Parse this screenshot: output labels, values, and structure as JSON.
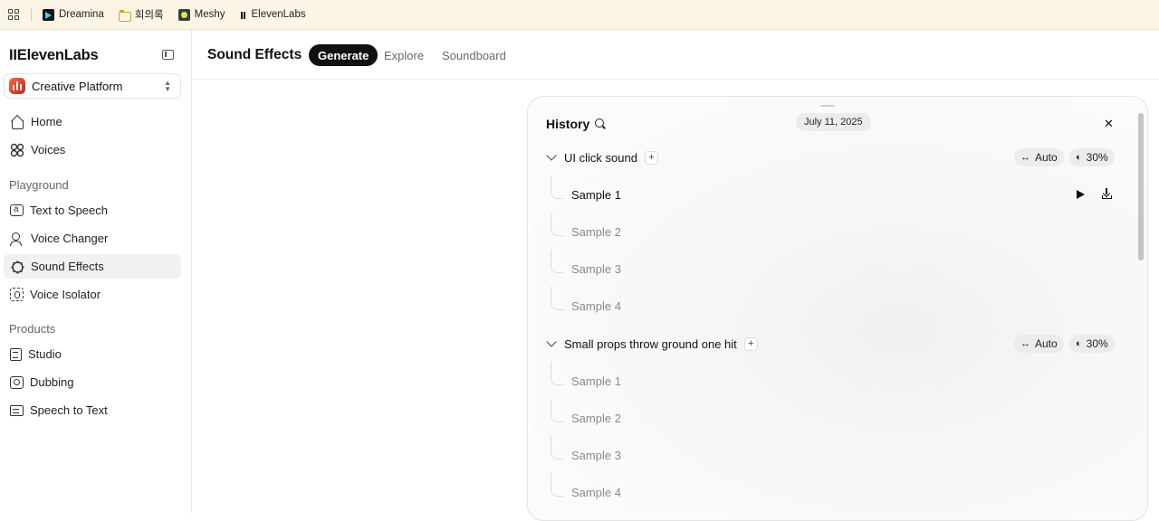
{
  "bookmarks": [
    {
      "label": "Dreamina",
      "icon": "dreamina-icon"
    },
    {
      "label": "회의록",
      "icon": "folder-icon"
    },
    {
      "label": "Meshy",
      "icon": "meshy-icon"
    },
    {
      "label": "ElevenLabs",
      "icon": "elevenlabs-icon"
    }
  ],
  "sidebar": {
    "logo": "IIElevenLabs",
    "workspace": "Creative Platform",
    "items": [
      {
        "label": "Home",
        "icon": "home-icon"
      },
      {
        "label": "Voices",
        "icon": "voices-icon"
      }
    ],
    "sections": [
      {
        "title": "Playground",
        "items": [
          {
            "label": "Text to Speech",
            "icon": "text-to-speech-icon"
          },
          {
            "label": "Voice Changer",
            "icon": "voice-changer-icon"
          },
          {
            "label": "Sound Effects",
            "icon": "sound-effects-icon",
            "active": true
          },
          {
            "label": "Voice Isolator",
            "icon": "voice-isolator-icon"
          }
        ]
      },
      {
        "title": "Products",
        "items": [
          {
            "label": "Studio",
            "icon": "studio-icon"
          },
          {
            "label": "Dubbing",
            "icon": "dubbing-icon"
          },
          {
            "label": "Speech to Text",
            "icon": "speech-to-text-icon"
          }
        ]
      }
    ]
  },
  "header": {
    "title": "Sound Effects",
    "tabs": [
      {
        "label": "Generate",
        "active": true
      },
      {
        "label": "Explore"
      },
      {
        "label": "Soundboard"
      }
    ]
  },
  "history": {
    "title": "History",
    "date": "July 11, 2025",
    "groups": [
      {
        "title": "UI click sound",
        "duration": "Auto",
        "influence": "30%",
        "samples": [
          "Sample 1",
          "Sample 2",
          "Sample 3",
          "Sample 4"
        ],
        "active_sample": 0
      },
      {
        "title": "Small props throw ground one hit",
        "duration": "Auto",
        "influence": "30%",
        "samples": [
          "Sample 1",
          "Sample 2",
          "Sample 3",
          "Sample 4"
        ]
      }
    ]
  },
  "colors": {
    "accent": "#111111",
    "bookmark_bar": "#fcf5e6",
    "chip_bg": "#ececec",
    "workspace_icon": "#e0462c"
  }
}
